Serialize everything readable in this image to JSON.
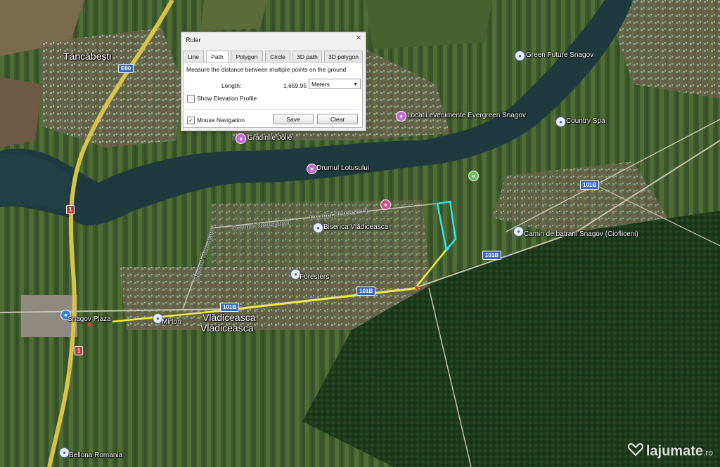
{
  "ruler": {
    "title": "Ruler",
    "tabs": [
      "Line",
      "Path",
      "Polygon",
      "Circle",
      "3D path",
      "3D polygon"
    ],
    "active_tab": "Path",
    "description": "Measure the distance between multiple points on the ground",
    "length_label": "Length:",
    "length_value": "1,659.95",
    "unit": "Meters",
    "show_elevation_profile": "Show Elevation Profile",
    "mouse_navigation": "Mouse Navigation",
    "mouse_navigation_checked": true,
    "save_label": "Save",
    "clear_label": "Clear"
  },
  "places": {
    "tancabesti": "Tâncăbești",
    "green_future": "Green Future Snagov",
    "locatii": "Locatii evenimente Evergreen Snagov",
    "country_spa": "Country Spa",
    "gradinile": "Gradinile Jolie",
    "drumul_lotusului": "Drumul Lotusului",
    "drumul_reteasterii_1": "Drumul Reteasterii",
    "drumul_reteasterii_2": "Drumul Reteasterii",
    "drumul_reteasterii_3": "Drumul Reteasterii",
    "biserica": "Biserica Vlădiceasca",
    "camin": "Camin de batrani Snagov (Ciofliceni)",
    "foresters": "Foresters",
    "snagov_plaza": "Snagov Plaza",
    "mirton": "Mirton",
    "vladiceasca_1": "Vlădiceasca",
    "vladiceasca_2": "Vlădiceasca",
    "bellona": "Bellona Romania"
  },
  "roads": {
    "e60": "E60",
    "r101b_1": "101B",
    "r101b_2": "101B",
    "r101b_3": "101B",
    "r101b_4": "101B",
    "r1_1": "1",
    "r1_2": "1"
  },
  "watermark": {
    "name": "lajumate",
    "tld": ".ro"
  },
  "colors": {
    "measure_path": "#f2f03a",
    "parcel_outline": "#34e1f2",
    "route_dots": "#e03b2c",
    "lake": "#1f3a3f"
  }
}
